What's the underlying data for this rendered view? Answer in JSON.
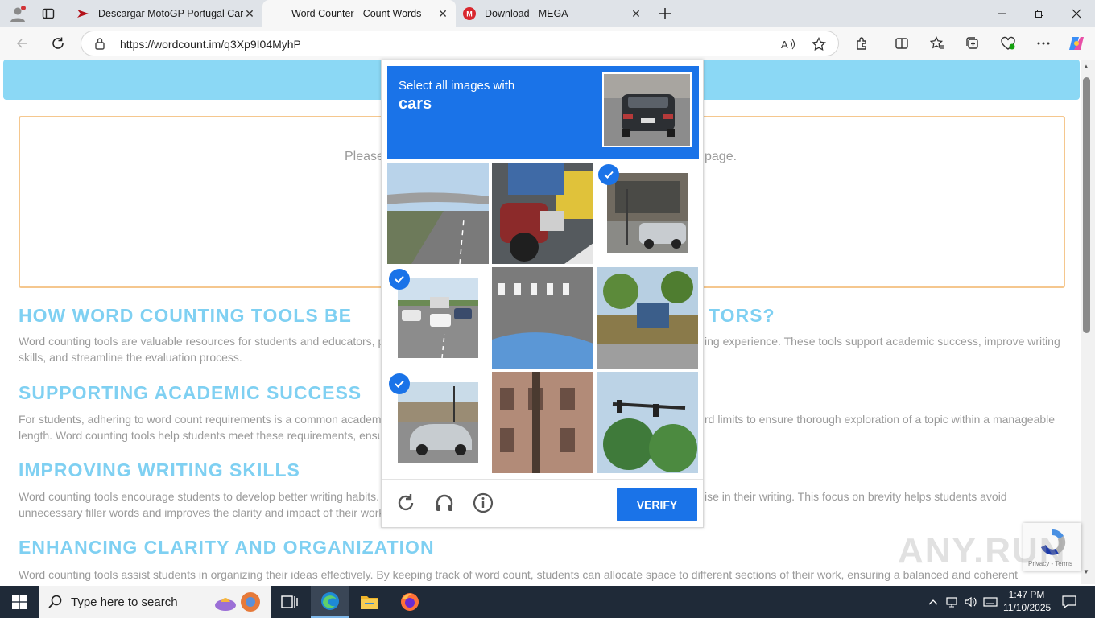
{
  "tabs": [
    {
      "title": "Descargar MotoGP Portugal Carre",
      "active": false
    },
    {
      "title": "Word Counter - Count Words",
      "active": true
    },
    {
      "title": "Download - MEGA",
      "active": false
    }
  ],
  "address": {
    "url": "https://wordcount.im/q3Xp9I04MyhP"
  },
  "page": {
    "placeholder_left": "Please",
    "placeholder_right": "page.",
    "sections": [
      {
        "heading": "HOW WORD COUNTING TOOLS BE",
        "heading_tail": "TORS?",
        "line1_left": "Word counting tools are valuable resources for students and educators, p",
        "line1_right": "ing experience. These tools support academic success, improve writing",
        "line2": "skills, and streamline the evaluation process."
      },
      {
        "heading": "SUPPORTING ACADEMIC SUCCESS",
        "line1_left": "For students, adhering to word count requirements is a common academ",
        "line1_right": "rd limits to ensure thorough exploration of a topic within a manageable",
        "line2": "length. Word counting tools help students meet these requirements, ensu"
      },
      {
        "heading": "IMPROVING WRITING SKILLS",
        "line1_left": "Word counting tools encourage students to develop better writing habits.",
        "line1_right": "ise in their writing. This focus on brevity helps students avoid",
        "line2": "unnecessary filler words and improves the clarity and impact of their work"
      },
      {
        "heading": "ENHANCING CLARITY AND ORGANIZATION",
        "line1": "Word counting tools assist students in organizing their ideas effectively. By keeping track of word count, students can allocate space to different sections of their work, ensuring a balanced and coherent"
      }
    ]
  },
  "captcha": {
    "instruction": "Select all images with",
    "target": "cars",
    "verify_label": "VERIFY",
    "selected_tiles": [
      3,
      4,
      7
    ]
  },
  "recaptcha": {
    "terms": "Privacy - Terms"
  },
  "watermark": "ANY.RUN",
  "taskbar": {
    "search_placeholder": "Type here to search",
    "time": "1:47 PM",
    "date": "11/10/2025"
  },
  "colors": {
    "accent": "#1a73e8",
    "heading": "#7fd0f2",
    "banner": "#8bd8f5",
    "box_border": "#f5c78e"
  }
}
